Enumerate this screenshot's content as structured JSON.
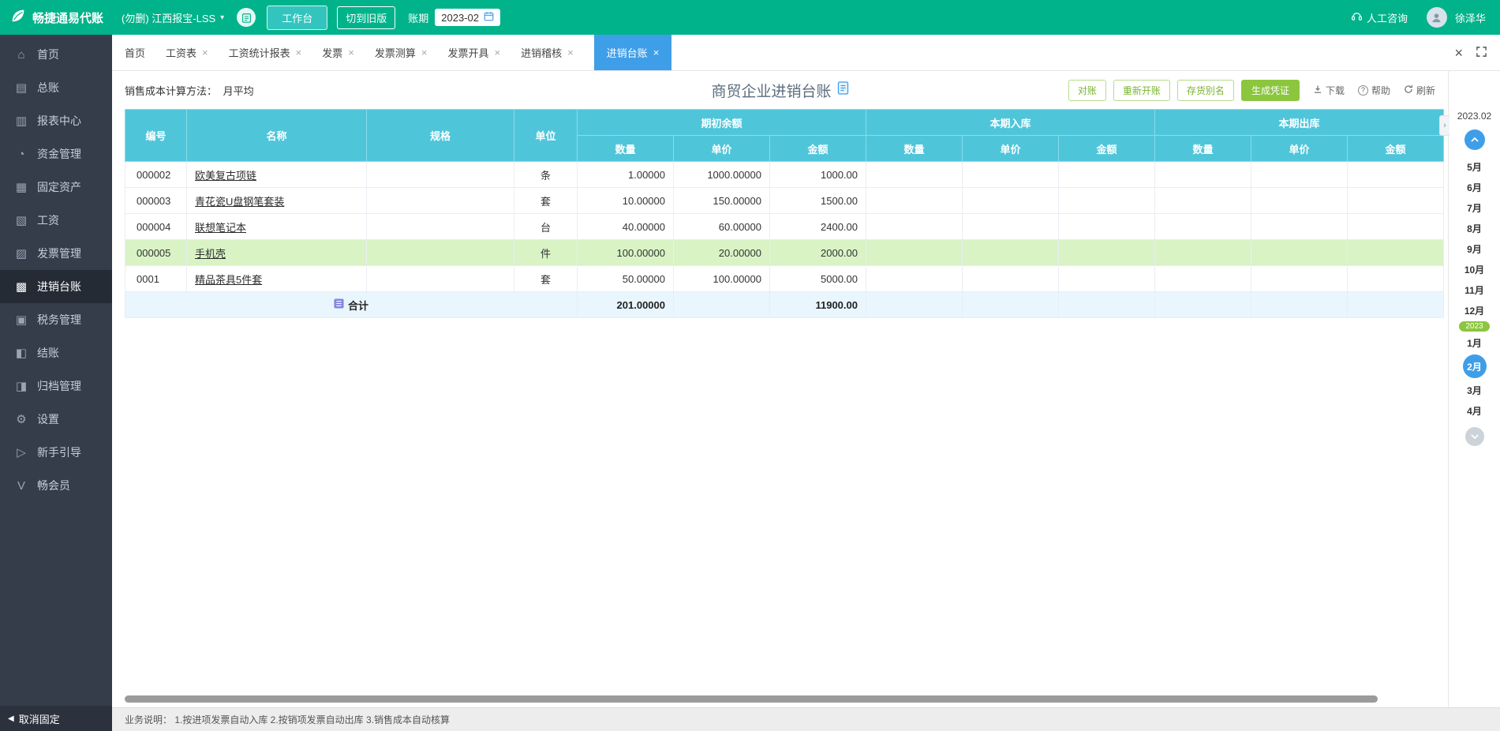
{
  "icons": {
    "close": "×",
    "chevron_down": "▾",
    "collapse": "›",
    "unpin": "◀"
  },
  "topbar": {
    "logo_text": "畅捷通易代账",
    "company_select": "(勿删) 江西报宝-LSS",
    "workbench_btn": "工作台",
    "switch_old_btn": "切到旧版",
    "period_label": "账期",
    "period_value": "2023-02",
    "consult_label": "人工咨询",
    "username": "徐泽华"
  },
  "sidebar": {
    "items": [
      {
        "label": "首页",
        "icon": "⌂"
      },
      {
        "label": "总账",
        "icon": "▤"
      },
      {
        "label": "报表中心",
        "icon": "▥"
      },
      {
        "label": "资金管理",
        "icon": "◔"
      },
      {
        "label": "固定资产",
        "icon": "▦"
      },
      {
        "label": "工资",
        "icon": "▧"
      },
      {
        "label": "发票管理",
        "icon": "▨"
      },
      {
        "label": "进销台账",
        "icon": "▩"
      },
      {
        "label": "税务管理",
        "icon": "▣"
      },
      {
        "label": "结账",
        "icon": "◧"
      },
      {
        "label": "归档管理",
        "icon": "◨"
      },
      {
        "label": "设置",
        "icon": "⚙"
      },
      {
        "label": "新手引导",
        "icon": "▷"
      },
      {
        "label": "畅会员",
        "icon": "V"
      }
    ],
    "unpin": "取消固定"
  },
  "tabs": [
    {
      "label": "首页"
    },
    {
      "label": "工资表"
    },
    {
      "label": "工资统计报表"
    },
    {
      "label": "发票"
    },
    {
      "label": "发票测算"
    },
    {
      "label": "发票开具"
    },
    {
      "label": "进销稽核"
    },
    {
      "label": "进销台账"
    }
  ],
  "toolbar": {
    "method_label": "销售成本计算方法：",
    "method_value": "月平均",
    "title": "商贸企业进销台账",
    "btn_reconcile": "对账",
    "btn_reopen": "重新开账",
    "btn_alias": "存货别名",
    "btn_voucher": "生成凭证",
    "download": "下载",
    "help": "帮助",
    "refresh": "刷新"
  },
  "table": {
    "columns": [
      "编号",
      "名称",
      "规格",
      "单位"
    ],
    "groups": [
      "期初余额",
      "本期入库",
      "本期出库"
    ],
    "subcols": [
      "数量",
      "单价",
      "金额"
    ],
    "rows": [
      {
        "code": "000002",
        "name": "欧美复古项链",
        "unit": "条",
        "qty": "1.00000",
        "price": "1000.00000",
        "amount": "1000.00"
      },
      {
        "code": "000003",
        "name": "青花瓷U盘钢笔套装",
        "unit": "套",
        "qty": "10.00000",
        "price": "150.00000",
        "amount": "1500.00"
      },
      {
        "code": "000004",
        "name": "联想笔记本",
        "unit": "台",
        "qty": "40.00000",
        "price": "60.00000",
        "amount": "2400.00"
      },
      {
        "code": "000005",
        "name": "手机壳",
        "unit": "件",
        "qty": "100.00000",
        "price": "20.00000",
        "amount": "2000.00"
      },
      {
        "code": "0001",
        "name": "精品茶具5件套",
        "unit": "套",
        "qty": "50.00000",
        "price": "100.00000",
        "amount": "5000.00"
      }
    ],
    "total": {
      "label": "合计",
      "qty": "201.00000",
      "amount": "11900.00"
    }
  },
  "month_panel": {
    "current": "2023.02",
    "months": [
      "5月",
      "6月",
      "7月",
      "8月",
      "9月",
      "10月",
      "11月",
      "12月"
    ],
    "year_badge": "2023",
    "months2": [
      "1月",
      "2月",
      "3月",
      "4月"
    ]
  },
  "footer": {
    "note": "业务说明： 1.按进项发票自动入库  2.按销项发票自动出库  3.销售成本自动核算"
  }
}
